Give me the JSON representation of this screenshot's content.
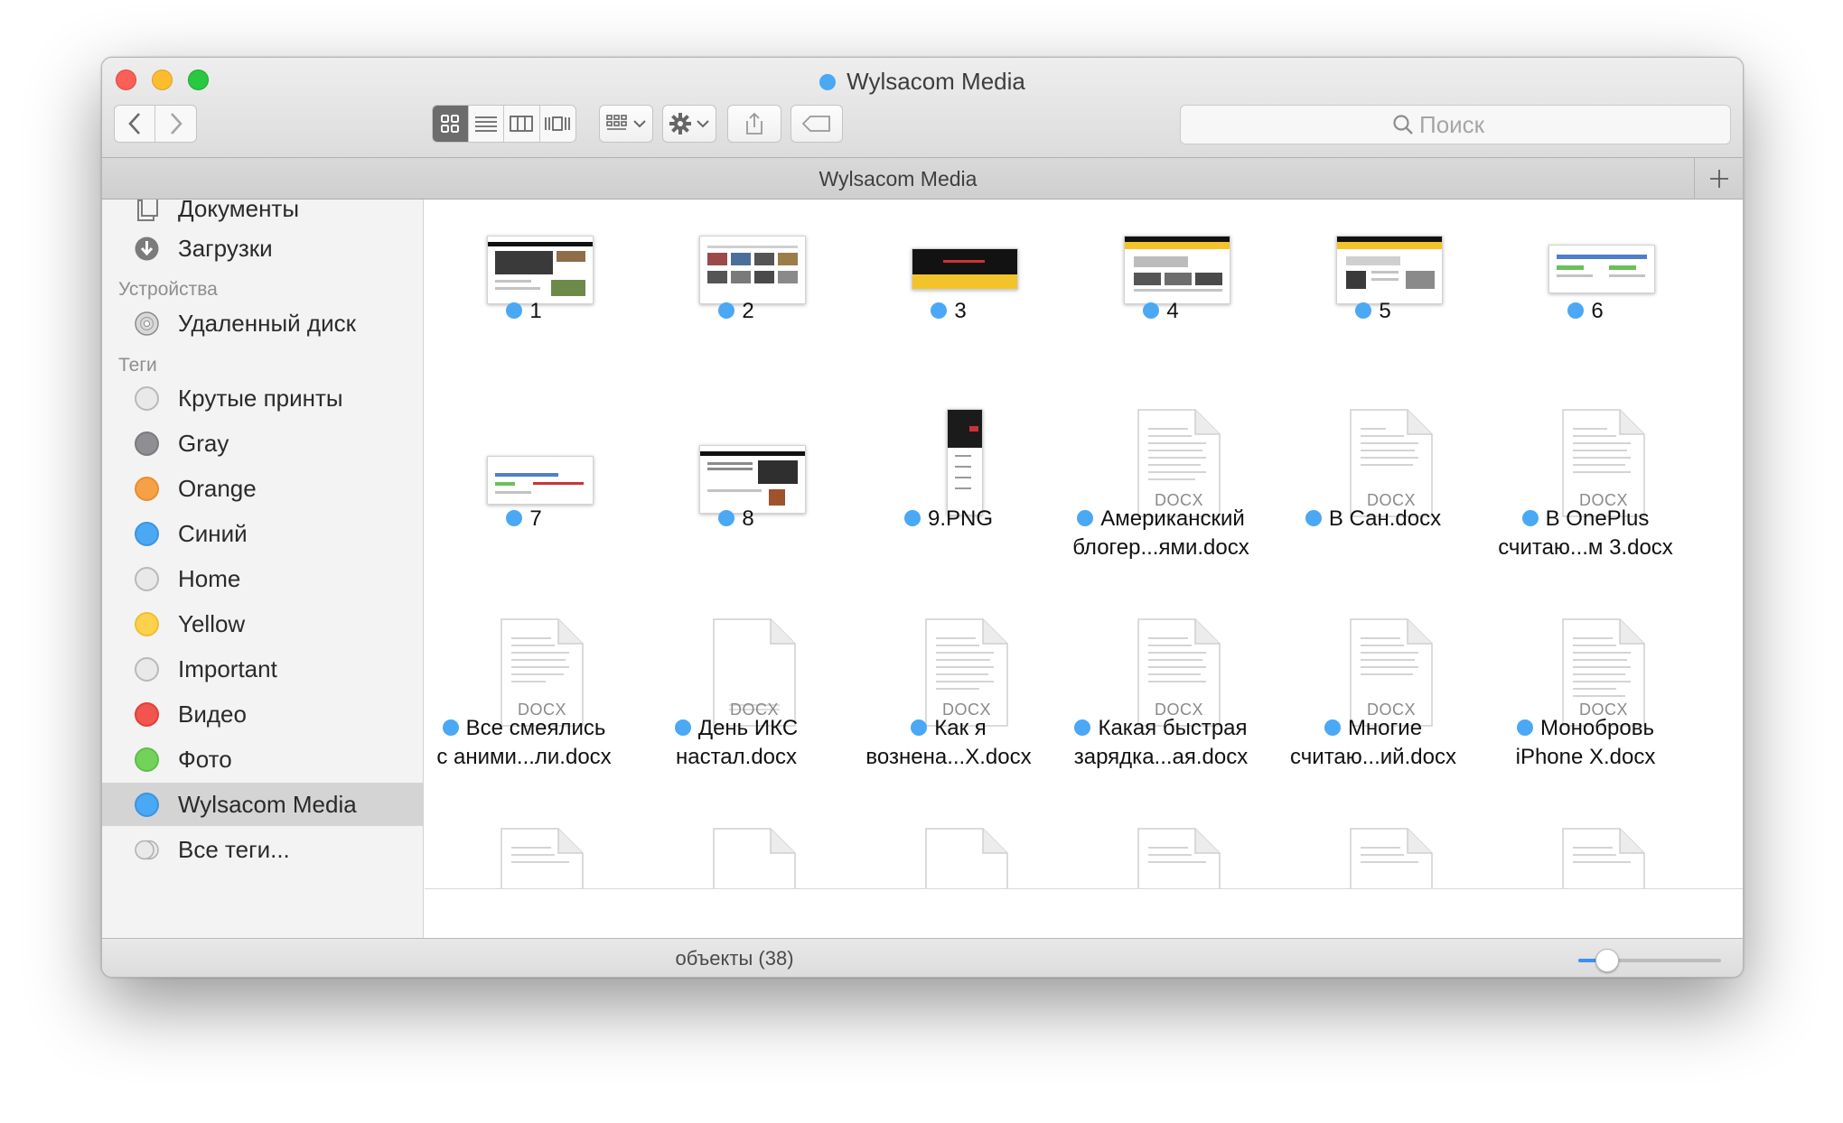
{
  "window": {
    "title": "Wylsacom Media",
    "tag_color": "#4aa8f4"
  },
  "toolbar": {
    "view_modes": [
      "icon-view",
      "list-view",
      "column-view",
      "cover-flow-view"
    ],
    "active_view": "icon-view",
    "arrange_icon": "grid-arrange-icon",
    "action_icon": "gear-icon",
    "share_icon": "share-icon",
    "tags_icon": "tag-icon",
    "search_placeholder": "Поиск"
  },
  "tabbar": {
    "title": "Wylsacom Media"
  },
  "sidebar": {
    "favorites": [
      {
        "label": "Документы",
        "icon": "documents-icon"
      },
      {
        "label": "Загрузки",
        "icon": "downloads-icon"
      }
    ],
    "devices_header": "Устройства",
    "devices": [
      {
        "label": "Удаленный диск",
        "icon": "remote-disc-icon"
      }
    ],
    "tags_header": "Теги",
    "tags": [
      {
        "label": "Крутые принты",
        "color": "#e9e9e9"
      },
      {
        "label": "Gray",
        "color": "#8e8e93"
      },
      {
        "label": "Orange",
        "color": "#f6a047"
      },
      {
        "label": "Синий",
        "color": "#4aa8f4"
      },
      {
        "label": "Home",
        "color": "#e9e9e9"
      },
      {
        "label": "Yellow",
        "color": "#fcd24d"
      },
      {
        "label": "Important",
        "color": "#e9e9e9"
      },
      {
        "label": "Видео",
        "color": "#f2554d"
      },
      {
        "label": "Фото",
        "color": "#73d25a"
      },
      {
        "label": "Wylsacom Media",
        "color": "#4aa8f4",
        "selected": true
      }
    ],
    "all_tags": "Все теги..."
  },
  "files": {
    "row1": [
      {
        "name": "1",
        "kind": "screenshot"
      },
      {
        "name": "2",
        "kind": "screenshot"
      },
      {
        "name": "3",
        "kind": "screenshot"
      },
      {
        "name": "4",
        "kind": "screenshot"
      },
      {
        "name": "5",
        "kind": "screenshot"
      },
      {
        "name": "6",
        "kind": "screenshot"
      }
    ],
    "row2": [
      {
        "name": "7",
        "kind": "screenshot"
      },
      {
        "name": "8",
        "kind": "screenshot"
      },
      {
        "name": "9.PNG",
        "kind": "phone-screenshot"
      },
      {
        "name_l1": "Американский",
        "name_l2": "блогер...ями.docx",
        "kind": "docx",
        "ext": "DOCX"
      },
      {
        "name": "В Сан.docx",
        "kind": "docx",
        "ext": "DOCX"
      },
      {
        "name_l1": "В OnePlus",
        "name_l2": "считаю...м 3.docx",
        "kind": "docx",
        "ext": "DOCX"
      }
    ],
    "row3": [
      {
        "name_l1": "Все смеялись",
        "name_l2": "с аними...ли.docx",
        "kind": "docx",
        "ext": "DOCX"
      },
      {
        "name_l1": "День ИКС",
        "name_l2": "настал.docx",
        "kind": "docx",
        "ext": "DOCX"
      },
      {
        "name_l1": "Как я",
        "name_l2": "вознена...X.docx",
        "kind": "docx",
        "ext": "DOCX"
      },
      {
        "name_l1": "Какая быстрая",
        "name_l2": "зарядка...ая.docx",
        "kind": "docx",
        "ext": "DOCX"
      },
      {
        "name_l1": "Многие",
        "name_l2": "считаю...ий.docx",
        "kind": "docx",
        "ext": "DOCX"
      },
      {
        "name_l1": "Монобровь",
        "name_l2": "iPhone X.docx",
        "kind": "docx",
        "ext": "DOCX"
      }
    ]
  },
  "status": {
    "text": "объекты (38)",
    "icon_size_fraction": 0.2
  }
}
